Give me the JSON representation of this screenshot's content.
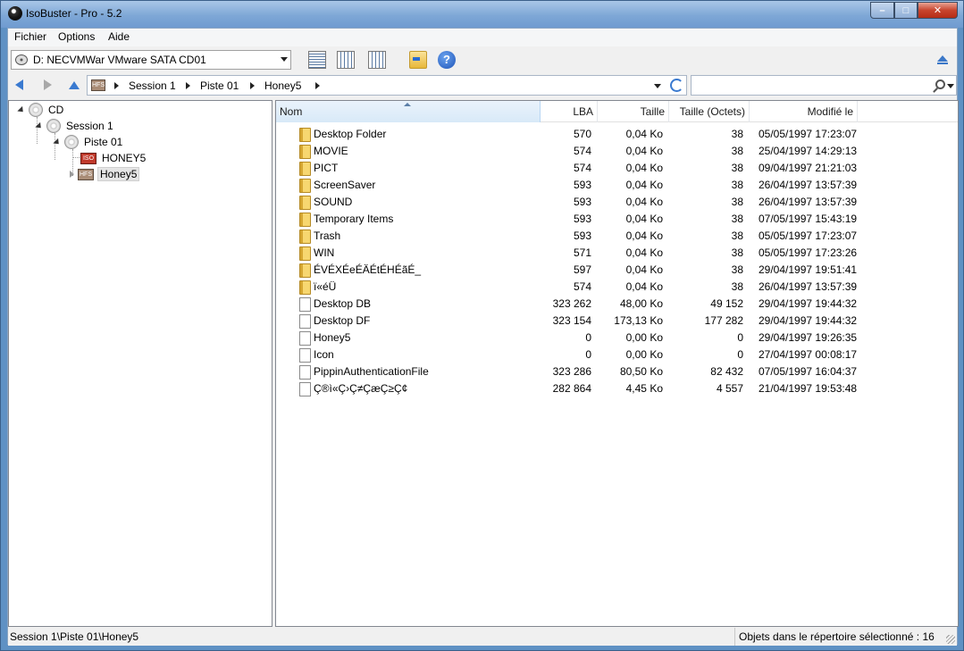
{
  "window": {
    "title": "IsoBuster - Pro - 5.2"
  },
  "menu": {
    "items": [
      "Fichier",
      "Options",
      "Aide"
    ]
  },
  "toolbar": {
    "drive": "D: NECVMWar VMware SATA CD01"
  },
  "address": {
    "crumbs": [
      "Session 1",
      "Piste 01",
      "Honey5"
    ],
    "root_icon_text": "HFS"
  },
  "tree": {
    "nodes": [
      "CD",
      "Session 1",
      "Piste 01",
      "HONEY5",
      "Honey5"
    ]
  },
  "list": {
    "columns": [
      "Nom",
      "LBA",
      "Taille",
      "Taille (Octets)",
      "Modifié le"
    ],
    "rows": [
      {
        "type": "folder",
        "name": "Desktop Folder",
        "lba": "570",
        "size": "0,04 Ko",
        "bytes": "38",
        "date": "05/05/1997 17:23:07"
      },
      {
        "type": "folder",
        "name": "MOVIE",
        "lba": "574",
        "size": "0,04 Ko",
        "bytes": "38",
        "date": "25/04/1997 14:29:13"
      },
      {
        "type": "folder",
        "name": "PICT",
        "lba": "574",
        "size": "0,04 Ko",
        "bytes": "38",
        "date": "09/04/1997 21:21:03"
      },
      {
        "type": "folder",
        "name": "ScreenSaver",
        "lba": "593",
        "size": "0,04 Ko",
        "bytes": "38",
        "date": "26/04/1997 13:57:39"
      },
      {
        "type": "folder",
        "name": "SOUND",
        "lba": "593",
        "size": "0,04 Ko",
        "bytes": "38",
        "date": "26/04/1997 13:57:39"
      },
      {
        "type": "folder",
        "name": "Temporary Items",
        "lba": "593",
        "size": "0,04 Ko",
        "bytes": "38",
        "date": "07/05/1997 15:43:19"
      },
      {
        "type": "folder",
        "name": "Trash",
        "lba": "593",
        "size": "0,04 Ko",
        "bytes": "38",
        "date": "05/05/1997 17:23:07"
      },
      {
        "type": "folder",
        "name": "WIN",
        "lba": "571",
        "size": "0,04 Ko",
        "bytes": "38",
        "date": "05/05/1997 17:23:26"
      },
      {
        "type": "folder",
        "name": "ÉVÉXÉeÉÄÉtÉHÉãÉ_",
        "lba": "597",
        "size": "0,04 Ko",
        "bytes": "38",
        "date": "29/04/1997 19:51:41"
      },
      {
        "type": "folder",
        "name": "ï«éÜ",
        "lba": "574",
        "size": "0,04 Ko",
        "bytes": "38",
        "date": "26/04/1997 13:57:39"
      },
      {
        "type": "file",
        "name": "Desktop DB",
        "lba": "323 262",
        "size": "48,00 Ko",
        "bytes": "49 152",
        "date": "29/04/1997 19:44:32"
      },
      {
        "type": "file",
        "name": "Desktop DF",
        "lba": "323 154",
        "size": "173,13 Ko",
        "bytes": "177 282",
        "date": "29/04/1997 19:44:32"
      },
      {
        "type": "file",
        "name": "Honey5",
        "lba": "0",
        "size": "0,00 Ko",
        "bytes": "0",
        "date": "29/04/1997 19:26:35"
      },
      {
        "type": "file",
        "name": "Icon",
        "lba": "0",
        "size": "0,00 Ko",
        "bytes": "0",
        "date": "27/04/1997 00:08:17"
      },
      {
        "type": "file",
        "name": "PippinAuthenticationFile",
        "lba": "323 286",
        "size": "80,50 Ko",
        "bytes": "82 432",
        "date": "07/05/1997 16:04:37"
      },
      {
        "type": "file",
        "name": "Ç®ì«Ç›Ç≠ÇæÇ≥Ç¢",
        "lba": "282 864",
        "size": "4,45 Ko",
        "bytes": "4 557",
        "date": "21/04/1997 19:53:48"
      }
    ]
  },
  "status": {
    "path": "Session 1\\Piste 01\\Honey5",
    "count": "Objets dans le répertoire sélectionné : 16"
  }
}
